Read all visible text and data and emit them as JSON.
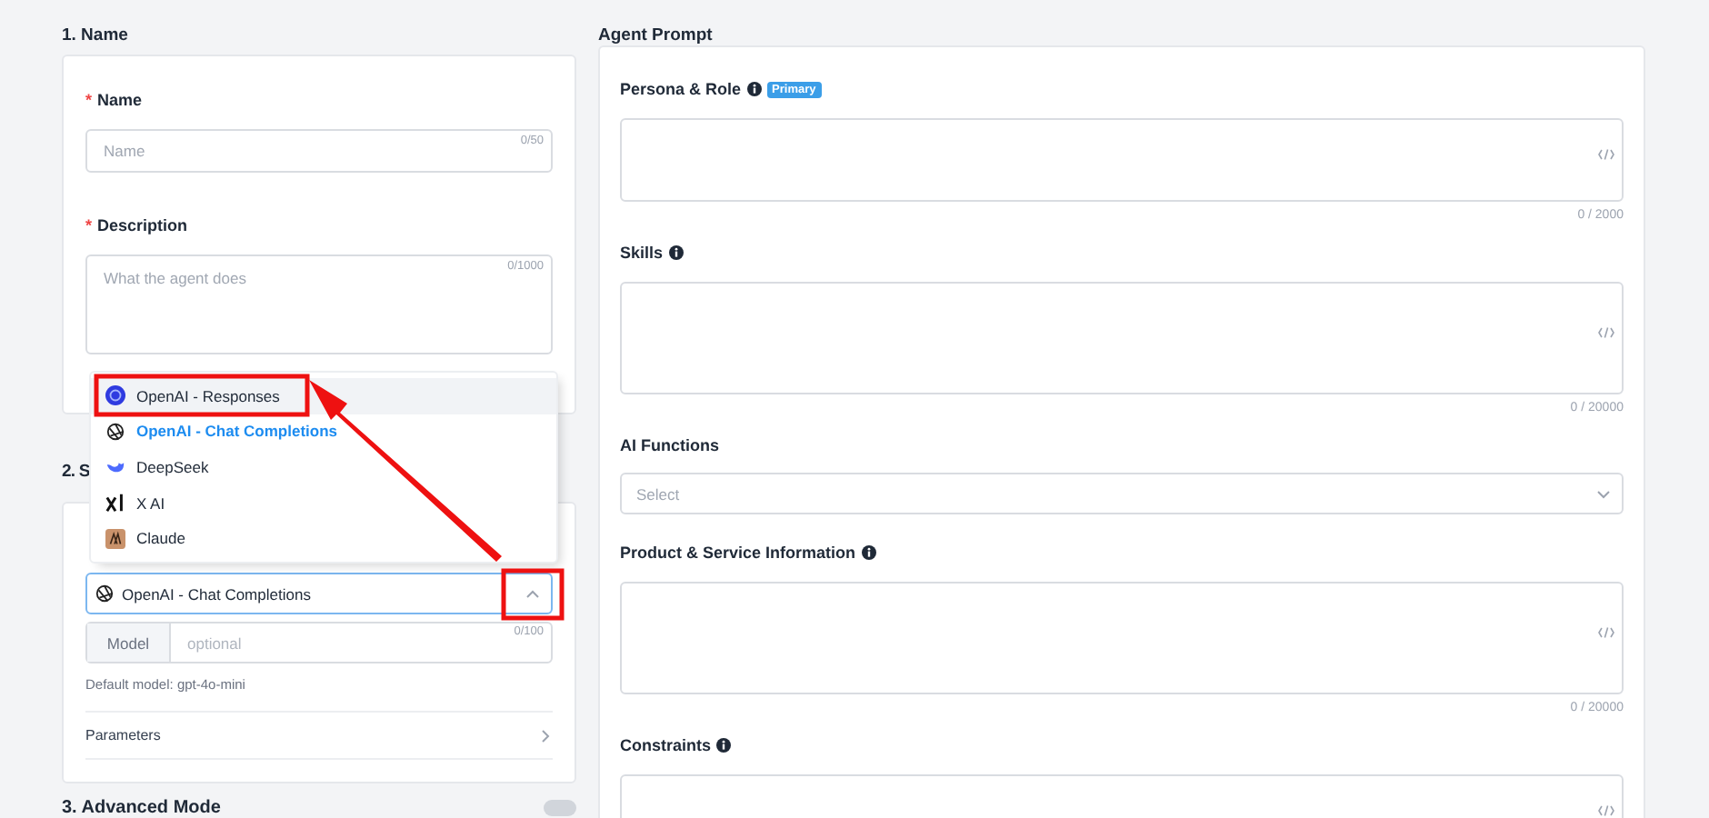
{
  "name_section": {
    "title": "1. Name",
    "fields": [
      {
        "label": "Name",
        "required_mark": "*",
        "kind": "input",
        "placeholder": "Name",
        "count": "0/50"
      },
      {
        "label": "Description",
        "required_mark": "*",
        "kind": "textarea",
        "placeholder": "What the agent does",
        "count": "0/1000"
      }
    ]
  },
  "model_section": {
    "title": "2. S",
    "provider_select": {
      "value": "OpenAI - Chat Completions",
      "expanded": true
    },
    "provider_options": [
      {
        "label": "OpenAI - Responses",
        "kind": "responses",
        "selected": false,
        "highlighted": true
      },
      {
        "label": "OpenAI - Chat Completions",
        "kind": "openai",
        "selected": true,
        "highlighted": false
      },
      {
        "label": "DeepSeek",
        "kind": "deepseek",
        "selected": false,
        "highlighted": false
      },
      {
        "label": "X AI",
        "kind": "xai",
        "selected": false,
        "highlighted": false
      },
      {
        "label": "Claude",
        "kind": "claude",
        "selected": false,
        "highlighted": false
      }
    ],
    "model_field": {
      "addon": "Model",
      "placeholder": "optional",
      "count": "0/100"
    },
    "hint": "Default model: gpt-4o-mini",
    "parameters": "Parameters"
  },
  "advanced_section": {
    "title": "3. Advanced Mode",
    "on": false
  },
  "agent_prompt": {
    "title": "Agent Prompt",
    "fields": [
      {
        "label": "Persona & Role",
        "kind": "textarea",
        "info": true,
        "badge": "Primary",
        "count": "0 / 2000"
      },
      {
        "label": "Skills",
        "kind": "textarea",
        "info": true,
        "count": "0 / 20000"
      },
      {
        "label": "AI Functions",
        "kind": "select",
        "info": false,
        "placeholder": "Select"
      },
      {
        "label": "Product & Service Information",
        "kind": "textarea",
        "info": true,
        "count": "0 / 20000"
      },
      {
        "label": "Constraints",
        "kind": "textarea",
        "info": true
      }
    ]
  }
}
